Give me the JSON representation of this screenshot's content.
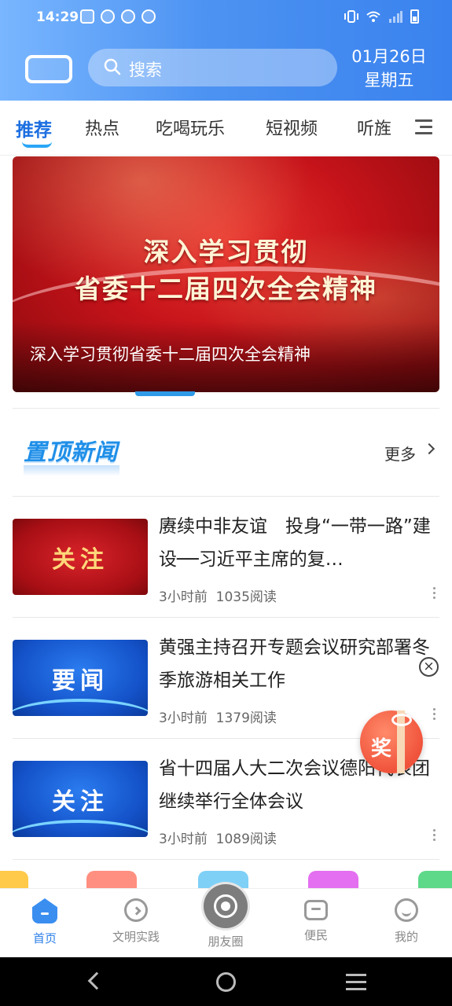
{
  "status_bar": {
    "time": "14:29"
  },
  "header": {
    "search_placeholder": "搜索",
    "date": "01月26日",
    "weekday": "星期五"
  },
  "tabs": [
    {
      "label": "推荐",
      "active": true
    },
    {
      "label": "热点"
    },
    {
      "label": "吃喝玩乐"
    },
    {
      "label": "短视频"
    },
    {
      "label": "听旌"
    }
  ],
  "banner": {
    "headline_line1": "深入学习贯彻",
    "headline_line2": "省委十二届四次全会精神",
    "caption": "深入学习贯彻省委十二届四次全会精神"
  },
  "pinned_section": {
    "title": "置顶新闻",
    "more_label": "更多"
  },
  "news": [
    {
      "thumb_text": "关注",
      "thumb_color": "red",
      "title": "赓续中非友谊　投身“一带一路”建设──习近平主席的复…",
      "time": "3小时前",
      "reads": "1035阅读"
    },
    {
      "thumb_text": "要闻",
      "thumb_color": "blue",
      "title": "黄强主持召开专题会议研究部署冬季旅游相关工作",
      "time": "3小时前",
      "reads": "1379阅读"
    },
    {
      "thumb_text": "关注",
      "thumb_color": "blue",
      "title": "省十四届人大二次会议德阳代表团继续举行全体会议",
      "time": "3小时前",
      "reads": "1089阅读"
    }
  ],
  "prize_float": {
    "label": "奖"
  },
  "bottom_nav": [
    {
      "label": "首页",
      "icon": "home-icon",
      "active": true
    },
    {
      "label": "文明实践",
      "icon": "compass-icon"
    },
    {
      "label": "朋友圈",
      "icon": "camera-icon"
    },
    {
      "label": "便民",
      "icon": "chat-icon"
    },
    {
      "label": "我的",
      "icon": "smile-icon"
    }
  ],
  "colors": {
    "header_gradient_start": "#79b6ff",
    "header_gradient_end": "#3a82ee",
    "accent": "#1d6fe0",
    "banner_red": "#c5131a",
    "nav_active": "#2c7fe8"
  }
}
